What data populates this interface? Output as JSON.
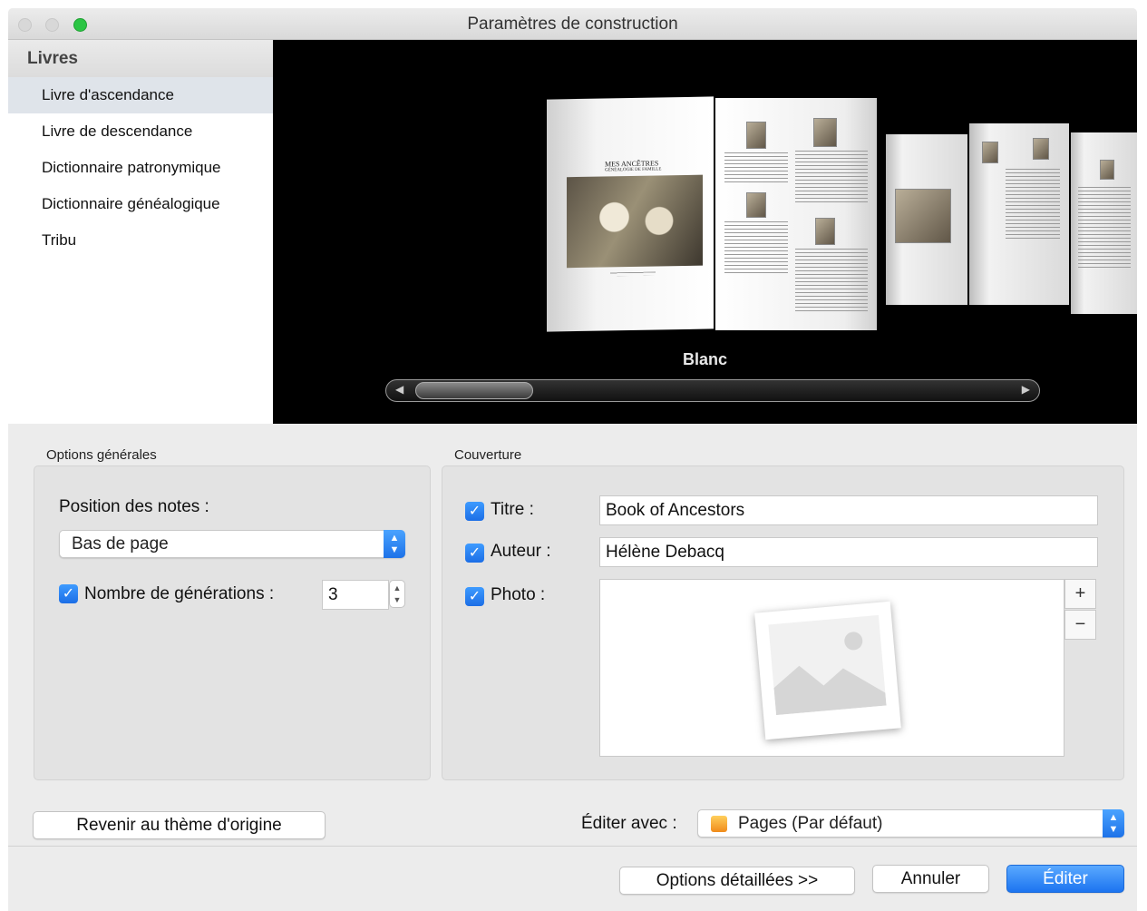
{
  "window": {
    "title": "Paramètres de construction"
  },
  "sidebar": {
    "header": "Livres",
    "items": [
      {
        "label": "Livre d'ascendance",
        "selected": true
      },
      {
        "label": "Livre de descendance"
      },
      {
        "label": "Dictionnaire patronymique"
      },
      {
        "label": "Dictionnaire généalogique"
      },
      {
        "label": "Tribu"
      }
    ]
  },
  "preview": {
    "theme_name": "Blanc",
    "cover_title": "MES ANCÊTRES",
    "cover_subtitle": "GÉNÉALOGIE DE FAMILLE"
  },
  "general_options": {
    "title": "Options générales",
    "notes_position_label": "Position des notes :",
    "notes_position_value": "Bas de page",
    "generations_checked": true,
    "generations_label": "Nombre de générations :",
    "generations_value": "3"
  },
  "cover": {
    "title": "Couverture",
    "title_label": "Titre :",
    "title_checked": true,
    "title_value": "Book of Ancestors",
    "author_label": "Auteur :",
    "author_checked": true,
    "author_value": "Hélène Debacq",
    "photo_label": "Photo :",
    "photo_checked": true,
    "add_label": "+",
    "remove_label": "−"
  },
  "footer": {
    "reset_theme_label": "Revenir au thème d'origine",
    "edit_with_label": "Éditer avec :",
    "edit_with_value": "Pages (Par défaut)",
    "detailed_options_label": "Options détaillées >>",
    "cancel_label": "Annuler",
    "edit_label": "Éditer"
  },
  "colors": {
    "accent": "#1c74f0",
    "traffic_green": "#2bc544"
  }
}
